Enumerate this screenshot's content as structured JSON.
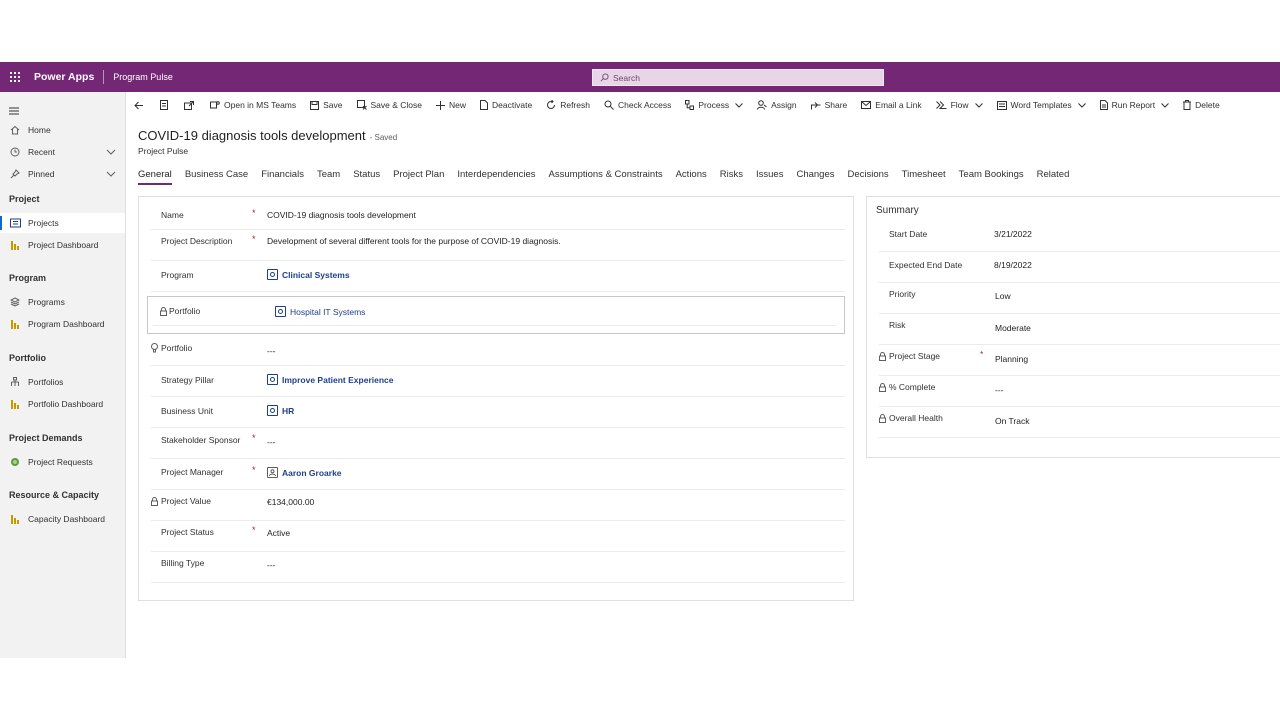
{
  "topbar": {
    "app_name": "Power Apps",
    "app_sub": "Program Pulse",
    "search_placeholder": "Search"
  },
  "sidebar": {
    "items_top": [
      {
        "label": "Home",
        "icon": "home-icon"
      },
      {
        "label": "Recent",
        "icon": "clock-icon"
      },
      {
        "label": "Pinned",
        "icon": "pin-icon"
      }
    ],
    "sections": [
      {
        "title": "Project",
        "items": [
          {
            "label": "Projects",
            "icon": "projects-icon",
            "active": true
          },
          {
            "label": "Project Dashboard",
            "icon": "dashboard-icon"
          }
        ]
      },
      {
        "title": "Program",
        "items": [
          {
            "label": "Programs",
            "icon": "layers-icon"
          },
          {
            "label": "Program Dashboard",
            "icon": "dashboard-icon"
          }
        ]
      },
      {
        "title": "Portfolio",
        "items": [
          {
            "label": "Portfolios",
            "icon": "hierarchy-icon"
          },
          {
            "label": "Portfolio Dashboard",
            "icon": "dashboard-icon"
          }
        ]
      },
      {
        "title": "Project Demands",
        "items": [
          {
            "label": "Project Requests",
            "icon": "globe-icon"
          }
        ]
      },
      {
        "title": "Resource & Capacity",
        "items": [
          {
            "label": "Capacity Dashboard",
            "icon": "dashboard-icon"
          }
        ]
      }
    ]
  },
  "commandbar": {
    "open_teams": "Open in MS Teams",
    "save": "Save",
    "save_close": "Save & Close",
    "new": "New",
    "deactivate": "Deactivate",
    "refresh": "Refresh",
    "check_access": "Check Access",
    "process": "Process",
    "assign": "Assign",
    "share": "Share",
    "email_link": "Email a Link",
    "flow": "Flow",
    "word_templates": "Word Templates",
    "run_report": "Run Report",
    "delete": "Delete"
  },
  "record": {
    "title": "COVID-19 diagnosis tools development",
    "saved": "- Saved",
    "entity": "Project Pulse"
  },
  "tabs": [
    "General",
    "Business Case",
    "Financials",
    "Team",
    "Status",
    "Project Plan",
    "Interdependencies",
    "Assumptions & Constraints",
    "Actions",
    "Risks",
    "Issues",
    "Changes",
    "Decisions",
    "Timesheet",
    "Team Bookings",
    "Related"
  ],
  "form": {
    "name_label": "Name",
    "name_value": "COVID-19 diagnosis tools development",
    "desc_label": "Project Description",
    "desc_value": "Development of several different tools for the purpose of COVID-19 diagnosis.",
    "program_label": "Program",
    "program_value": "Clinical Systems",
    "portfolio_locked_label": "Portfolio",
    "portfolio_locked_value": "Hospital IT Systems",
    "portfolio_label": "Portfolio",
    "portfolio_value": "---",
    "strategy_label": "Strategy Pillar",
    "strategy_value": "Improve Patient Experience",
    "bu_label": "Business Unit",
    "bu_value": "HR",
    "sponsor_label": "Stakeholder Sponsor",
    "sponsor_value": "---",
    "manager_label": "Project Manager",
    "manager_value": "Aaron Groarke",
    "value_label": "Project Value",
    "value_value": "€134,000.00",
    "status_label": "Project Status",
    "status_value": "Active",
    "billing_label": "Billing Type",
    "billing_value": "---",
    "required_mark": "*"
  },
  "summary": {
    "title": "Summary",
    "start_label": "Start Date",
    "start_value": "3/21/2022",
    "end_label": "Expected End Date",
    "end_value": "8/19/2022",
    "priority_label": "Priority",
    "priority_value": "Low",
    "risk_label": "Risk",
    "risk_value": "Moderate",
    "stage_label": "Project Stage",
    "stage_value": "Planning",
    "complete_label": "% Complete",
    "complete_value": "---",
    "health_label": "Overall Health",
    "health_value": "On Track"
  },
  "colors": {
    "brand": "#742774",
    "link": "#1e3f8a",
    "required": "#a4262c"
  }
}
